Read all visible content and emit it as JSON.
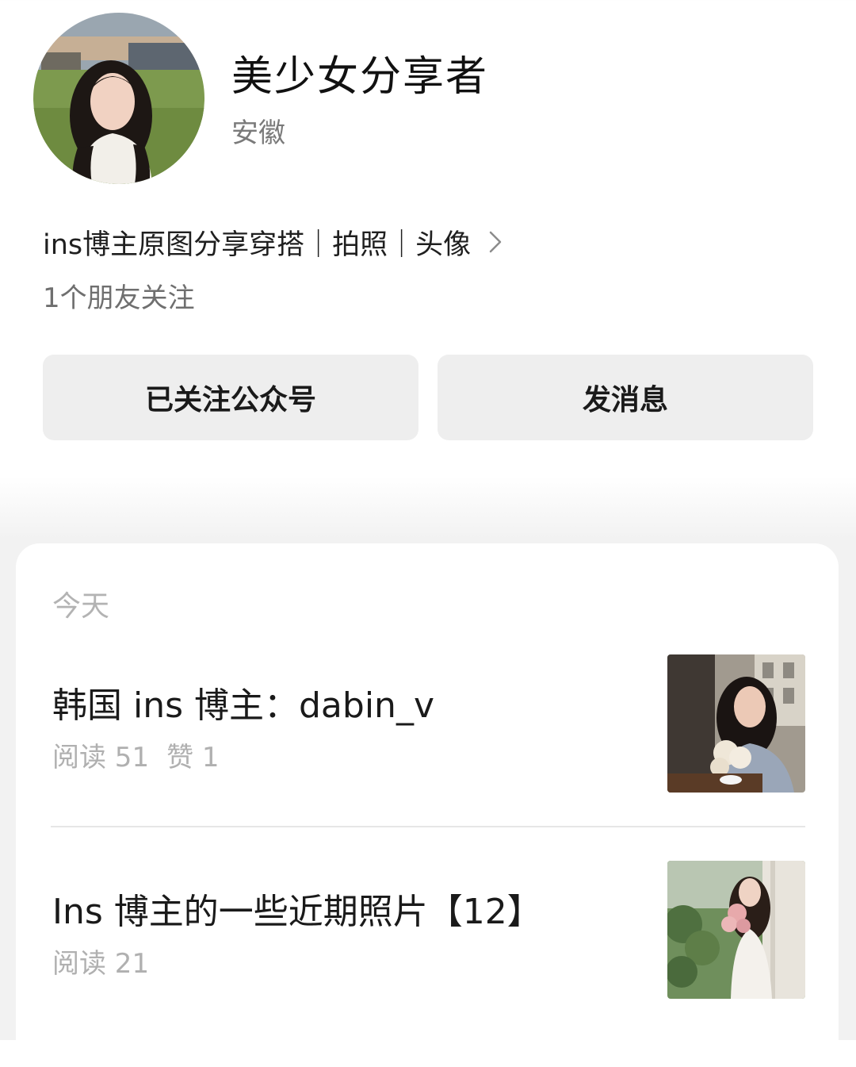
{
  "profile": {
    "avatar_icon": "avatar-photo",
    "name": "美少女分享者",
    "location": "安徽",
    "bio": "ins博主原图分享穿搭｜拍照｜头像",
    "followers": "1个朋友关注"
  },
  "actions": {
    "follow_label": "已关注公众号",
    "message_label": "发消息"
  },
  "articles": {
    "date_label": "今天",
    "items": [
      {
        "title": "韩国 ins 博主：dabin_v",
        "reads": "阅读 51",
        "likes": "赞 1",
        "thumbnail_icon": "article-thumbnail-photo"
      },
      {
        "title": "Ins 博主的一些近期照片【12】",
        "reads": "阅读 21",
        "thumbnail_icon": "article-thumbnail-photo"
      }
    ]
  },
  "colors": {
    "primary_text": "#1a1a1a",
    "secondary_text": "#7a7a7a",
    "muted_text": "#b0b0b0",
    "button_bg": "#eeeeee",
    "page_bg": "#f2f2f2",
    "card_bg": "#ffffff"
  }
}
